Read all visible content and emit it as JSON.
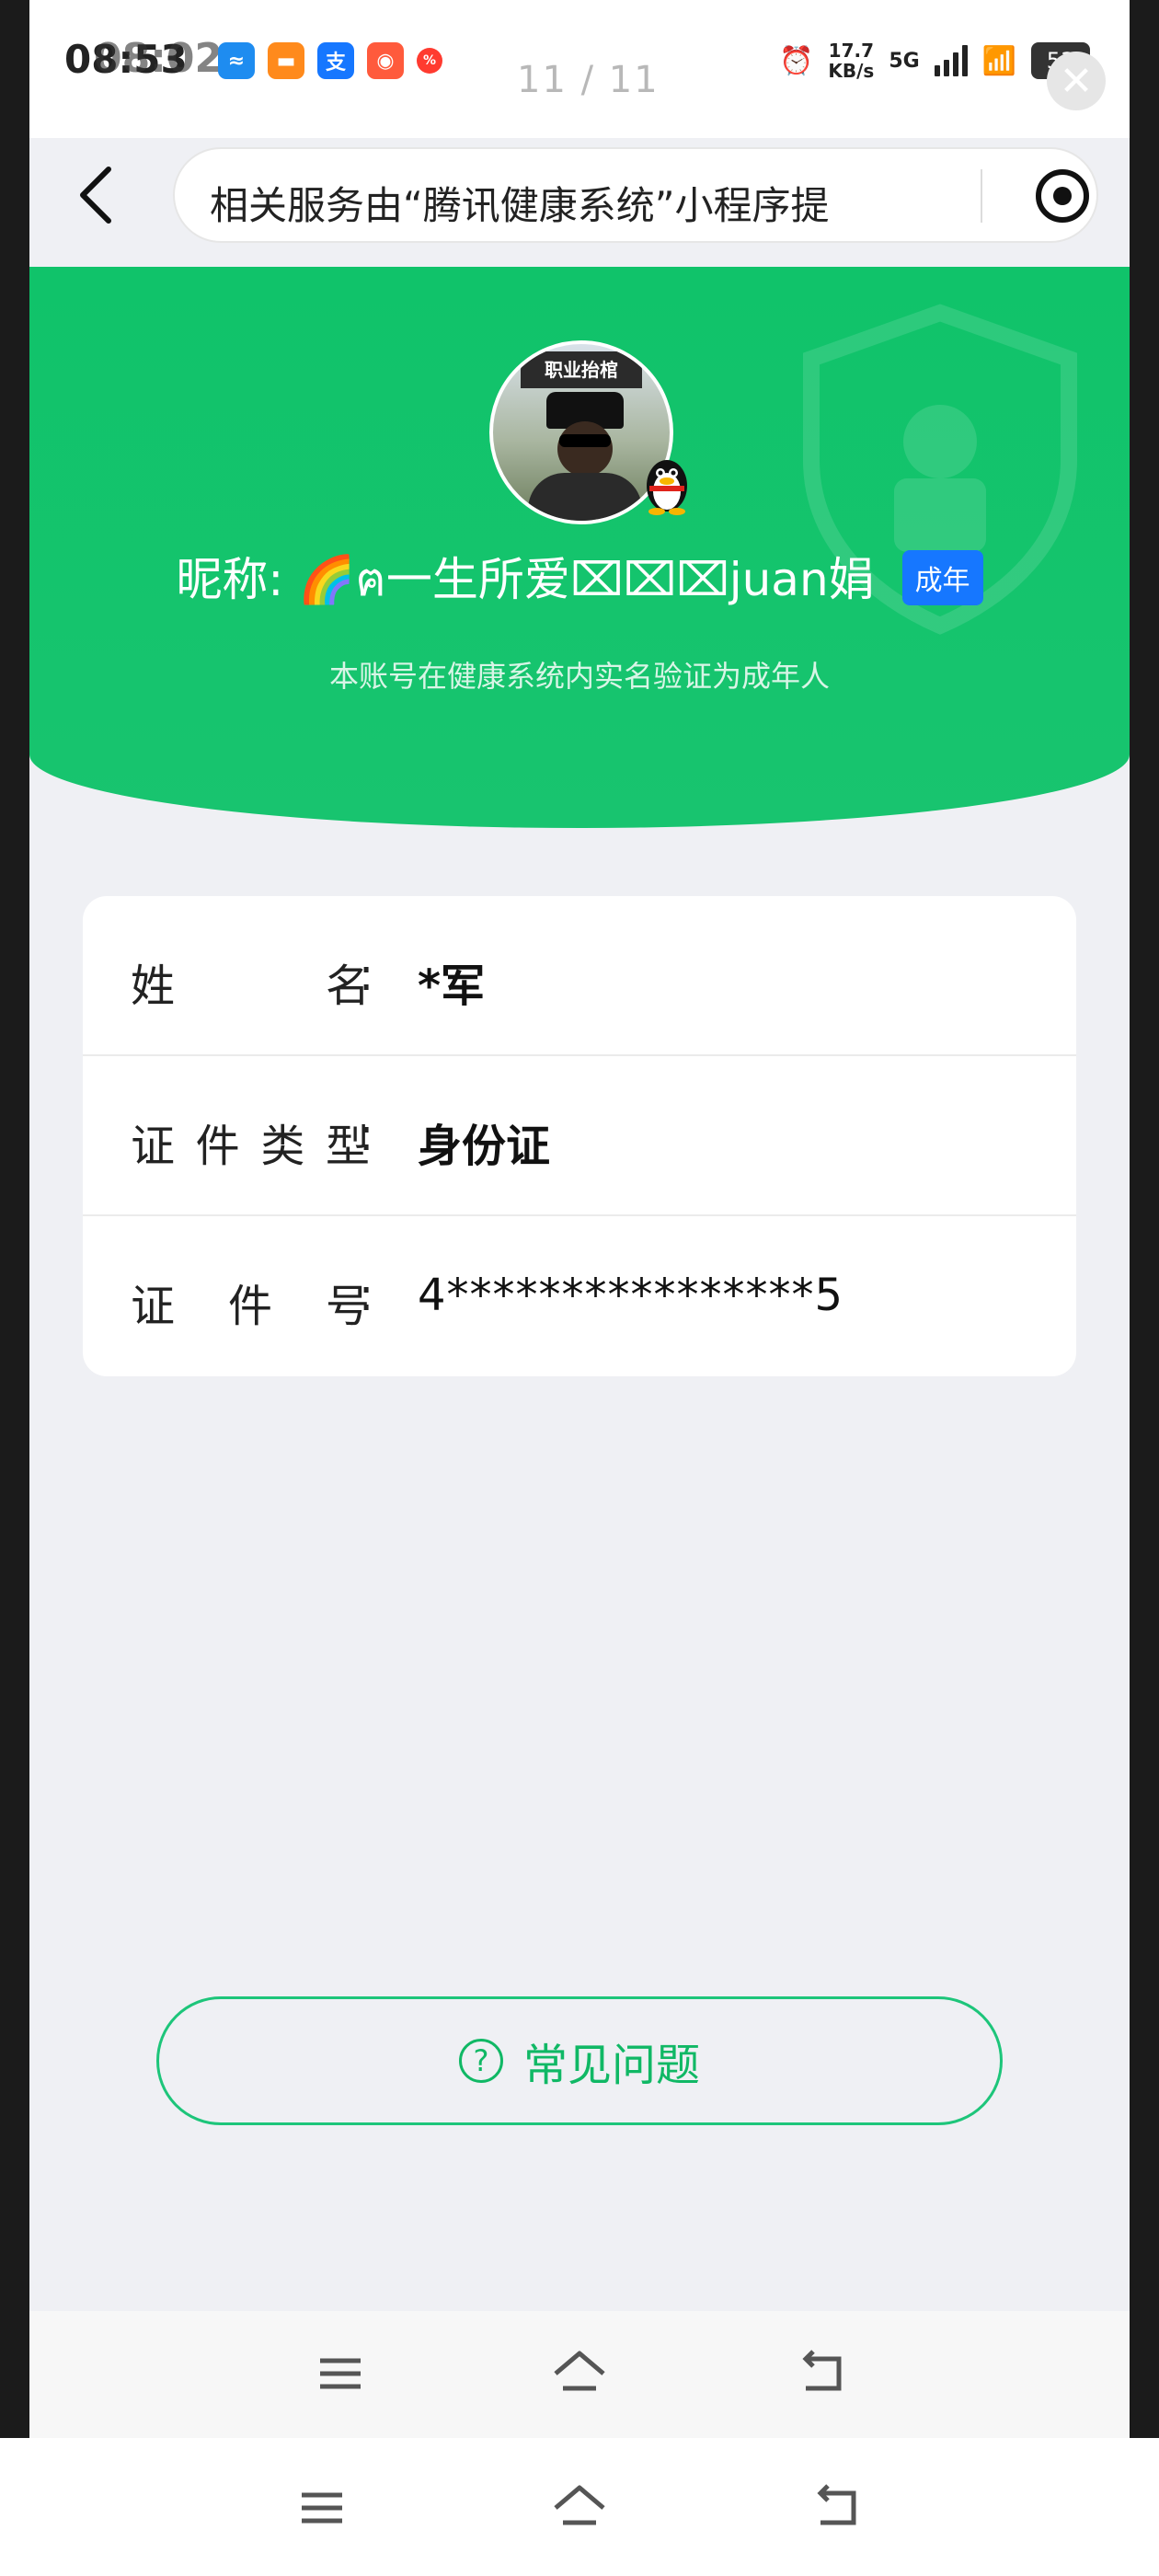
{
  "status_bar": {
    "time": "08:53",
    "time_overlay": "08:02",
    "pager": "11 / 11",
    "net_speed_value": "17.7",
    "net_speed_unit": "KB/s",
    "network_type": "5G",
    "battery": "53",
    "app_icons": [
      "app-icon-blue",
      "app-icon-orange",
      "alipay-icon",
      "app-icon-red",
      "app-icon-small-red"
    ],
    "colors": {
      "blue": "#1e8cf0",
      "orange": "#ff8a1c",
      "alipay": "#1677ff",
      "red": "#ff5a3c",
      "small_red": "#ff3b30"
    }
  },
  "header": {
    "url_text": "相关服务由“腾讯健康系统”小程序提"
  },
  "profile": {
    "avatar_badge": "职业抬棺",
    "nickname": "昵称: 🌈ฅ一生所爱⌧⌧⌧juan娟",
    "adult_tag": "成年",
    "subtitle": "本账号在健康系统内实名验证为成年人",
    "accent_color": "#14c36c"
  },
  "info": {
    "rows": [
      {
        "label": "姓名",
        "value": "*军"
      },
      {
        "label": "证件类型",
        "value": "身份证"
      },
      {
        "label": "证件号",
        "value": "4****************5"
      }
    ],
    "colon": ":"
  },
  "faq": {
    "icon": "question-icon",
    "label": "常见问题"
  },
  "nav": {
    "items": [
      "menu-icon",
      "home-icon",
      "back-icon"
    ]
  }
}
